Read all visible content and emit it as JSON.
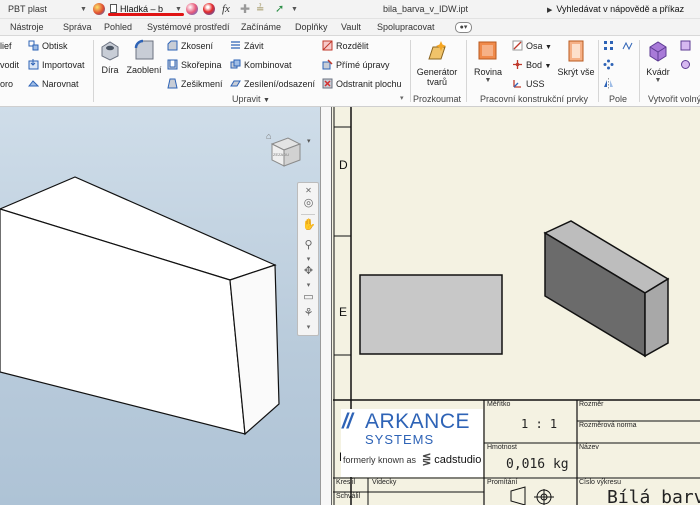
{
  "qat": {
    "material": "PBT plast",
    "appearance": "Hladká – b",
    "fx_label": "fx",
    "filename": "bila_barva_v_IDW.ipt",
    "help_search": "Vyhledávat v nápovědě a příkaz"
  },
  "tabs": [
    "Nástroje",
    "Správa",
    "Pohled",
    "Systémové prostředí",
    "Začínáme",
    "Doplňky",
    "Vault",
    "Spolupracovat"
  ],
  "ribbon": {
    "cut_left": [
      "lief",
      "vodit",
      "oro"
    ],
    "insert": [
      "Obtisk",
      "Importovat",
      "Narovnat"
    ],
    "modify_big": [
      "Díra",
      "Zaoblení"
    ],
    "modify_col1": [
      "Zkosení",
      "Skořepina",
      "Zešikmení"
    ],
    "modify_col2": [
      "Závit",
      "Kombinovat",
      "Zesílení/odsazení"
    ],
    "modify_col3": [
      "Rozdělit",
      "Přímé úpravy",
      "Odstranit plochu"
    ],
    "modify_label": "Upravit",
    "frame_gen": [
      "Generátor",
      "tvarů"
    ],
    "frame_label": "Prozkoumat",
    "work_big": [
      "Rovina",
      "Skrýt vše"
    ],
    "work_col": [
      "Osa",
      "Bod",
      "USS"
    ],
    "work_label": "Pracovní konstrukční prvky",
    "pattern_label": "Pole",
    "freeform_big": "Kvádr",
    "freeform_label": "Vytvořit volný"
  },
  "viewcube": {
    "face_label": "ZEZADU"
  },
  "drawing": {
    "zone_letters": [
      "D",
      "E",
      "F"
    ],
    "logo": {
      "brand": "ARKANCE",
      "sub": "SYSTEMS",
      "formerly": "formerly known as",
      "partner": "cadstudio"
    },
    "title_block": {
      "scale_label": "Měřítko",
      "scale_value": "1 : 1",
      "size_label": "Rozměr",
      "size_standard_label": "Rozměrová norma",
      "name_label": "Název",
      "mass_label": "Hmotnost",
      "mass_value": "0,016 kg",
      "projection_label": "Promítání",
      "drawing_no_label": "Číslo výkresu",
      "drawing_no_value": "Bílá barva",
      "drawn_label": "Kreslil",
      "drawn_value": "Videcky",
      "approved_label": "Schválil"
    }
  },
  "colors": {
    "viewport_bg": "#c3d4e3",
    "sheet_bg": "#f4f2e2",
    "arkance_blue": "#2e63b6",
    "red_underline": "#e01313"
  }
}
